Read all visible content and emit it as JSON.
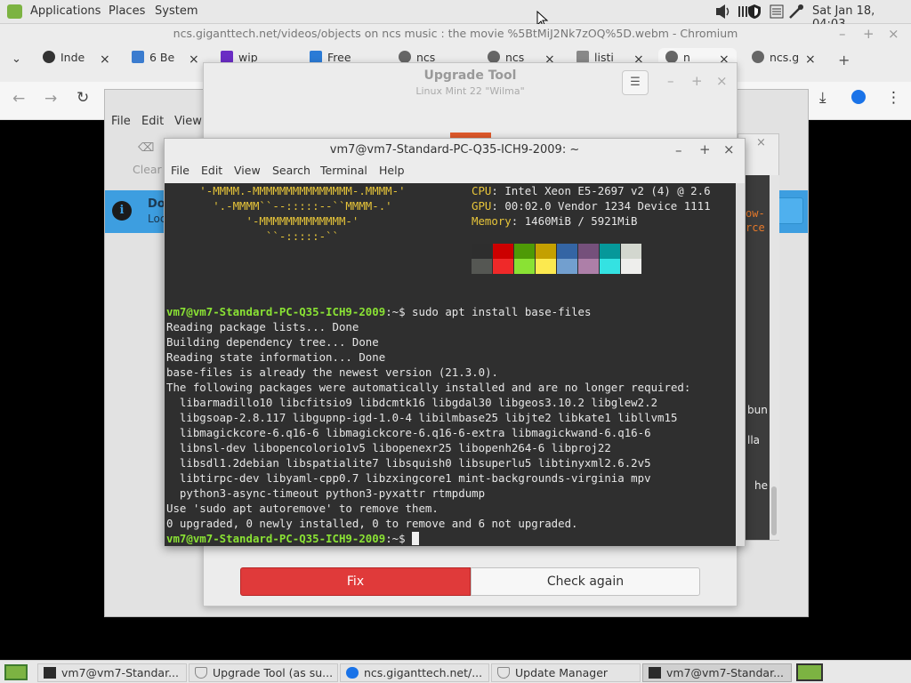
{
  "top_panel": {
    "menus": [
      "Applications",
      "Places",
      "System"
    ],
    "clock": "Sat Jan 18, 04:03",
    "tray_icons": [
      "volume-icon",
      "shield-icon",
      "keyboard-icon",
      "network-icon"
    ]
  },
  "chromium": {
    "title": "ncs.giganttech.net/videos/objects on ncs music :  the movie %5BtMiJ2Nk7zOQ%5D.webm - Chromium",
    "tabs": [
      {
        "label": "Inde",
        "icon": "github-icon"
      },
      {
        "label": "6 Be",
        "icon": "document-icon"
      },
      {
        "label": "wip",
        "icon": "yahoo-icon"
      },
      {
        "label": "Free",
        "icon": "dropbox-icon"
      },
      {
        "label": "ncs",
        "icon": "globe-icon"
      },
      {
        "label": "ncs",
        "icon": "globe-icon"
      },
      {
        "label": "listi",
        "icon": "page-icon"
      },
      {
        "label": "n",
        "icon": "globe-icon"
      },
      {
        "label": "ncs.g",
        "icon": "globe-icon"
      }
    ]
  },
  "file_manager": {
    "menus": [
      "File",
      "Edit",
      "View"
    ],
    "toolbar_clear": "Clear",
    "info_title": "Do",
    "info_sub": "Loc"
  },
  "upgrade_tool": {
    "title": "Upgrade Tool",
    "subtitle": "Linux Mint 22 \"Wilma\"",
    "fix_label": "Fix",
    "check_label": "Check again"
  },
  "update_manager_side": {
    "orange_lines": [
      "ow-",
      "rce"
    ],
    "white_lines": [
      "bun",
      "lla",
      "he"
    ]
  },
  "terminal": {
    "title": "vm7@vm7-Standard-PC-Q35-ICH9-2009: ~",
    "menus": [
      "File",
      "Edit",
      "View",
      "Search",
      "Terminal",
      "Help"
    ],
    "ascii": [
      "     '-MMMM.-MMMMMMMMMMMMMMM-.MMMM-'",
      "       '.-MMMM``--:::::--``MMMM-.'",
      "            '-MMMMMMMMMMMMM-'",
      "               ``-:::::-``"
    ],
    "sysinfo": [
      {
        "key": "CPU",
        "value": "Intel Xeon E5-2697 v2 (4) @ 2.6"
      },
      {
        "key": "GPU",
        "value": "00:02.0 Vendor 1234 Device 1111"
      },
      {
        "key": "Memory",
        "value": "1460MiB / 5921MiB"
      }
    ],
    "palette_top": [
      "#2e2e2e",
      "#cc0000",
      "#4e9a06",
      "#c4a000",
      "#3465a4",
      "#75507b",
      "#06989a",
      "#d3d7cf"
    ],
    "palette_bottom": [
      "#555753",
      "#ef2929",
      "#8ae234",
      "#fce94f",
      "#729fcf",
      "#ad7fa8",
      "#34e2e2",
      "#eeeeec"
    ],
    "prompt": "vm7@vm7-Standard-PC-Q35-ICH9-2009",
    "prompt_suffix": ":~$ ",
    "command": "sudo apt install base-files",
    "output": [
      "Reading package lists... Done",
      "Building dependency tree... Done",
      "Reading state information... Done",
      "base-files is already the newest version (21.3.0).",
      "The following packages were automatically installed and are no longer required:",
      "  libarmadillo10 libcfitsio9 libdcmtk16 libgdal30 libgeos3.10.2 libglew2.2",
      "  libgsoap-2.8.117 libgupnp-igd-1.0-4 libilmbase25 libjte2 libkate1 libllvm15",
      "  libmagickcore-6.q16-6 libmagickcore-6.q16-6-extra libmagickwand-6.q16-6",
      "  libnsl-dev libopencolorio1v5 libopenexr25 libopenh264-6 libproj22",
      "  libsdl1.2debian libspatialite7 libsquish0 libsuperlu5 libtinyxml2.6.2v5",
      "  libtirpc-dev libyaml-cpp0.7 libzxingcore1 mint-backgrounds-virginia mpv",
      "  python3-async-timeout python3-pyxattr rtmpdump",
      "Use 'sudo apt autoremove' to remove them.",
      "0 upgraded, 0 newly installed, 0 to remove and 6 not upgraded."
    ]
  },
  "taskbar": {
    "tasks": [
      {
        "label": "vm7@vm7-Standar...",
        "icon": "terminal-icon"
      },
      {
        "label": "Upgrade Tool (as su...",
        "icon": "shield-icon"
      },
      {
        "label": "ncs.giganttech.net/...",
        "icon": "chromium-icon"
      },
      {
        "label": "Update Manager",
        "icon": "shield-icon"
      },
      {
        "label": "vm7@vm7-Standar...",
        "icon": "terminal-icon"
      }
    ]
  }
}
